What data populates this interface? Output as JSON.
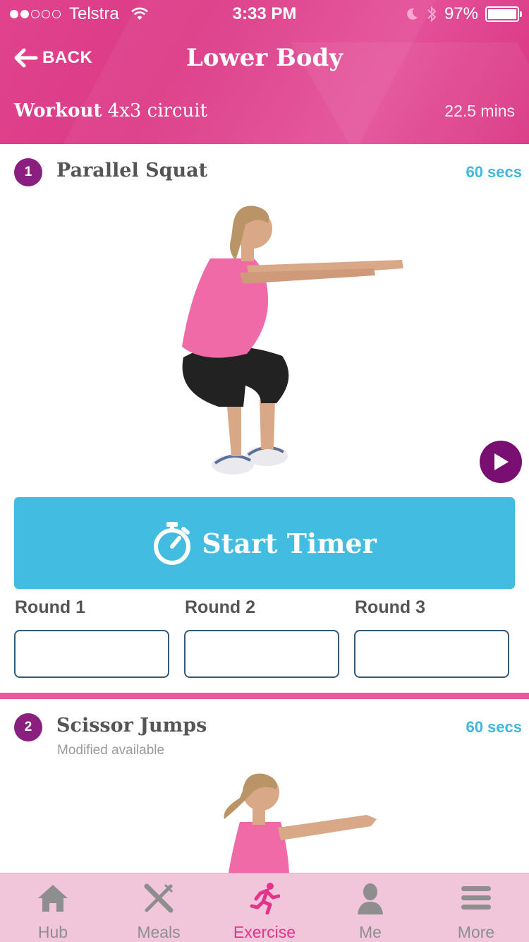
{
  "status_bar": {
    "carrier": "Telstra",
    "time": "3:33 PM",
    "battery": "97%"
  },
  "nav": {
    "back_label": "BACK",
    "title": "Lower Body"
  },
  "workout": {
    "label": "Workout",
    "type": "4x3 circuit",
    "duration": "22.5 mins"
  },
  "exercises": [
    {
      "number": "1",
      "name": "Parallel Squat",
      "duration": "60 secs",
      "timer_label": "Start Timer",
      "rounds": [
        {
          "label": "Round 1",
          "value": ""
        },
        {
          "label": "Round 2",
          "value": ""
        },
        {
          "label": "Round 3",
          "value": ""
        }
      ]
    },
    {
      "number": "2",
      "name": "Scissor Jumps",
      "subtitle": "Modified available",
      "duration": "60 secs"
    }
  ],
  "tabs": [
    {
      "label": "Hub",
      "icon": "home-icon",
      "active": false
    },
    {
      "label": "Meals",
      "icon": "fork-knife-icon",
      "active": false
    },
    {
      "label": "Exercise",
      "icon": "running-person-icon",
      "active": true
    },
    {
      "label": "Me",
      "icon": "person-icon",
      "active": false
    },
    {
      "label": "More",
      "icon": "menu-icon",
      "active": false
    }
  ],
  "colors": {
    "header_pink": "#dc3a86",
    "accent_blue": "#42bce0",
    "number_purple": "#8a1f80",
    "tab_active": "#e3338a",
    "tabbar_bg": "#f1c6db"
  }
}
